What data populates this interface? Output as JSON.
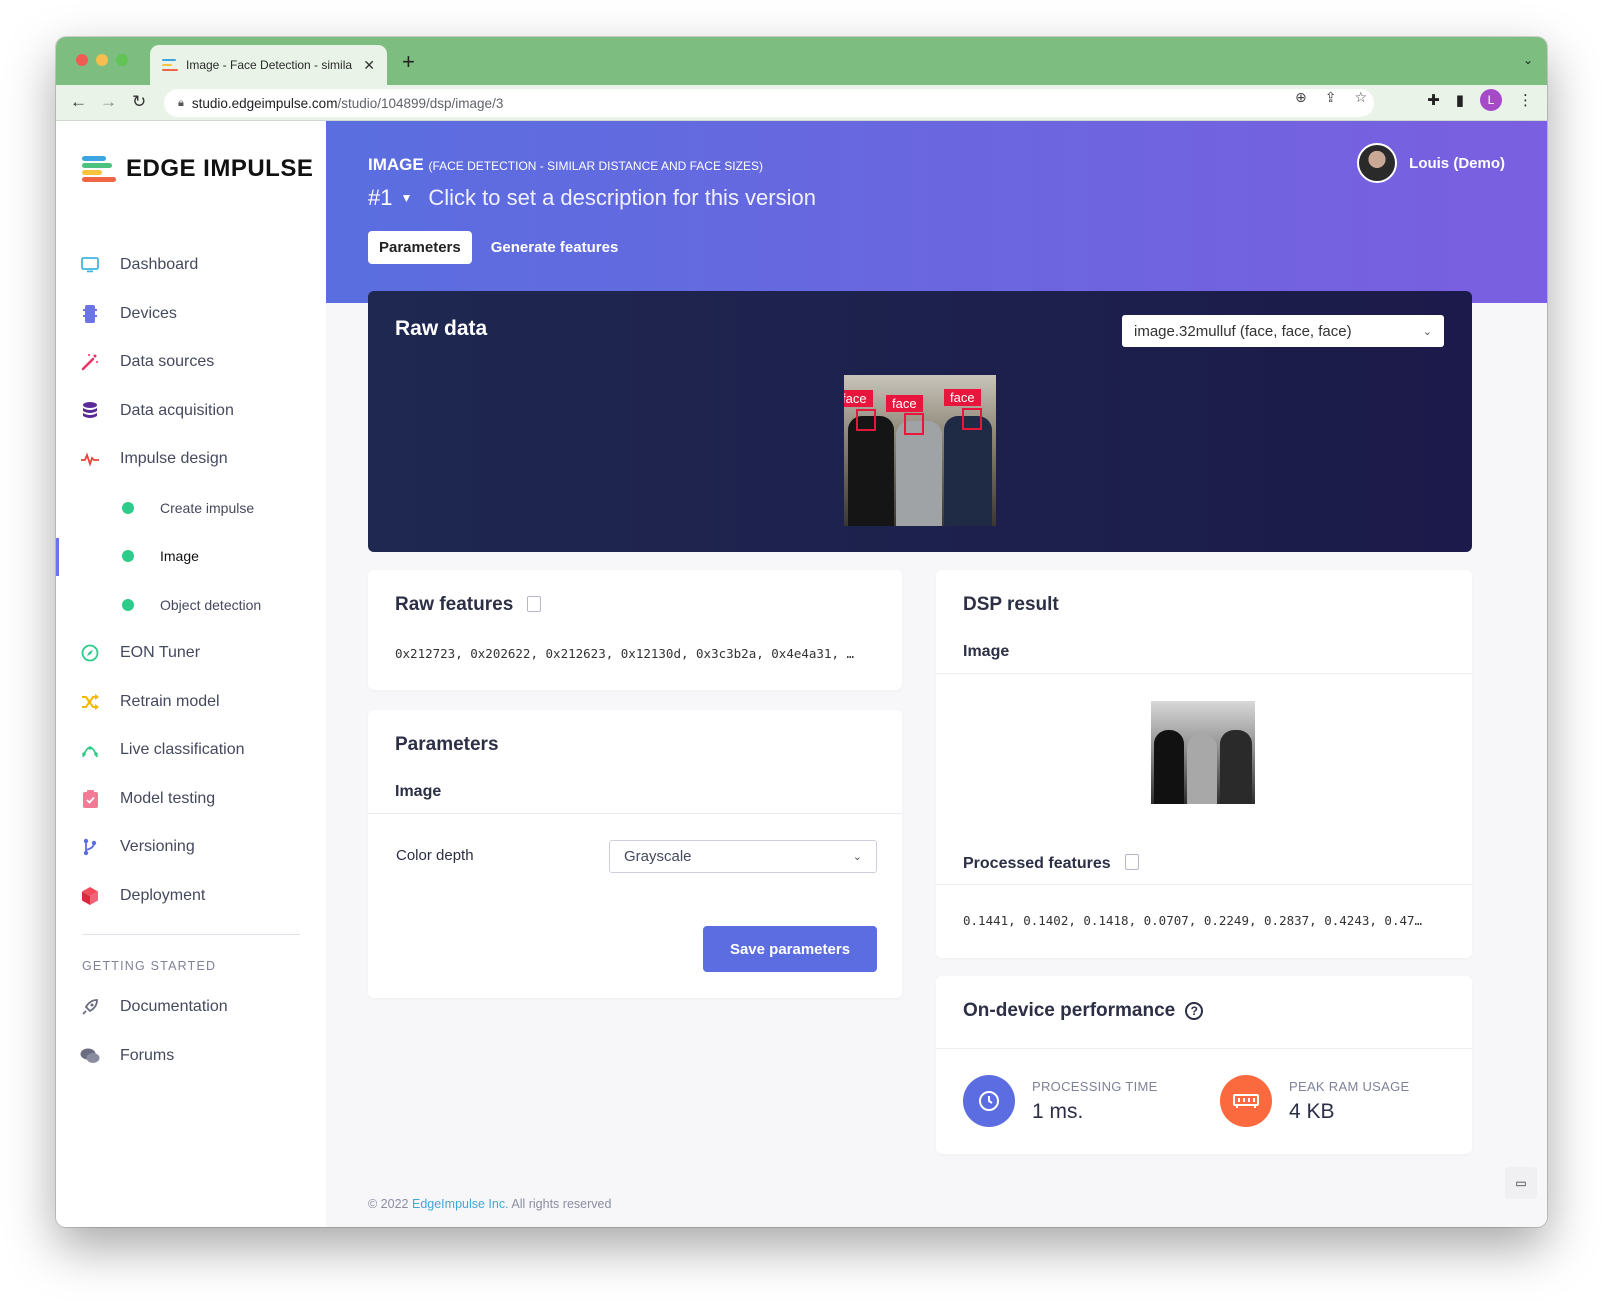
{
  "browser": {
    "tab_title": "Image - Face Detection - simila",
    "url_host": "studio.edgeimpulse.com",
    "url_path": "/studio/104899/dsp/image/3",
    "profile_initial": "L"
  },
  "sidebar": {
    "logo_text": "EDGE IMPULSE",
    "items": [
      {
        "label": "Dashboard",
        "icon": "monitor-icon"
      },
      {
        "label": "Devices",
        "icon": "chip-icon"
      },
      {
        "label": "Data sources",
        "icon": "magic-wand-icon"
      },
      {
        "label": "Data acquisition",
        "icon": "database-icon"
      },
      {
        "label": "Impulse design",
        "icon": "pulse-icon"
      },
      {
        "label": "Create impulse",
        "sub": true
      },
      {
        "label": "Image",
        "sub": true,
        "active": true
      },
      {
        "label": "Object detection",
        "sub": true
      },
      {
        "label": "EON Tuner",
        "icon": "compass-icon"
      },
      {
        "label": "Retrain model",
        "icon": "shuffle-icon"
      },
      {
        "label": "Live classification",
        "icon": "antenna-icon"
      },
      {
        "label": "Model testing",
        "icon": "clipboard-check-icon"
      },
      {
        "label": "Versioning",
        "icon": "branch-icon"
      },
      {
        "label": "Deployment",
        "icon": "cube-icon"
      }
    ],
    "getting_started_heading": "GETTING STARTED",
    "help_items": [
      {
        "label": "Documentation",
        "icon": "rocket-icon"
      },
      {
        "label": "Forums",
        "icon": "chat-bubbles-icon"
      }
    ]
  },
  "header": {
    "block_name": "IMAGE",
    "project_name": "(FACE DETECTION - SIMILAR DISTANCE AND FACE SIZES)",
    "version": "#1",
    "version_description": "Click to set a description for this version",
    "user_name": "Louis (Demo)",
    "tabs": [
      "Parameters",
      "Generate features"
    ]
  },
  "raw_data": {
    "title": "Raw data",
    "sample_selected": "image.32mulluf (face, face, face)",
    "labels": [
      "face",
      "face",
      "face"
    ]
  },
  "raw_features": {
    "title": "Raw features",
    "values": "0x212723, 0x202622, 0x212623, 0x12130d, 0x3c3b2a, 0x4e4a31, …"
  },
  "parameters": {
    "title": "Parameters",
    "section": "Image",
    "color_depth_label": "Color depth",
    "color_depth_value": "Grayscale",
    "save_label": "Save parameters"
  },
  "dsp_result": {
    "title": "DSP result",
    "section": "Image",
    "processed_title": "Processed features",
    "processed_values": "0.1441, 0.1402, 0.1418, 0.0707, 0.2249, 0.2837, 0.4243, 0.47…"
  },
  "performance": {
    "title": "On-device performance",
    "processing_label": "PROCESSING TIME",
    "processing_value": "1 ms.",
    "ram_label": "PEAK RAM USAGE",
    "ram_value": "4 KB"
  },
  "colors": {
    "accent": "#5b6de0",
    "dot_green": "#2ecc8b",
    "face_red": "#e8163c",
    "ram_orange": "#fb6a3e"
  },
  "footer": {
    "copyright": "© 2022",
    "company": "EdgeImpulse Inc.",
    "rights": "All rights reserved"
  }
}
